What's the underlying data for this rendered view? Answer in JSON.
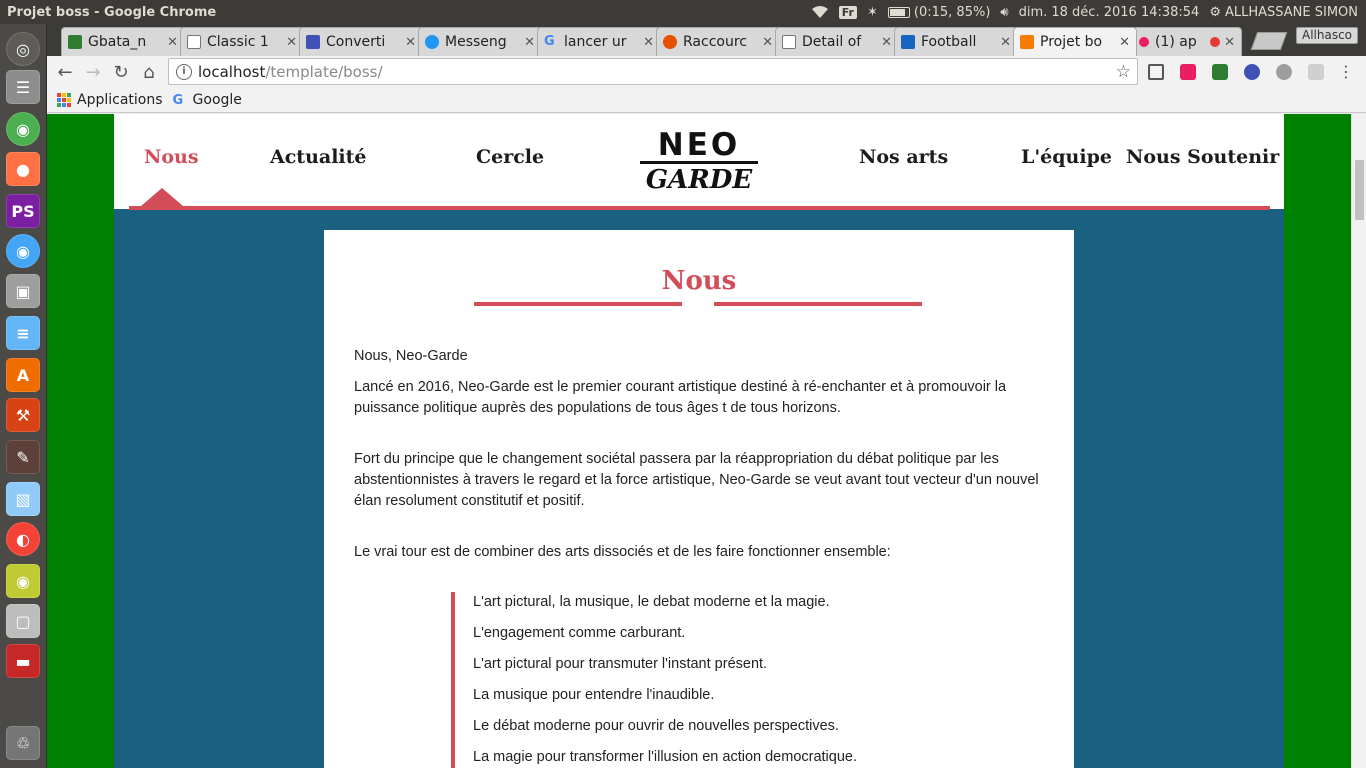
{
  "window": {
    "title": "Projet boss - Google Chrome"
  },
  "panel": {
    "keyboard": "Fr",
    "battery": "(0:15, 85%)",
    "datetime": "dim. 18 déc. 2016 14:38:54",
    "user": "ALLHASSANE SIMON"
  },
  "tabs": [
    {
      "label": "Gbata_n",
      "color": "#2e7d32"
    },
    {
      "label": "Classic 1",
      "color": "#ffffff"
    },
    {
      "label": "Converti",
      "color": "#3f51b5"
    },
    {
      "label": "Messeng",
      "color": "#2196f3"
    },
    {
      "label": "lancer ur",
      "color": "#ffffff"
    },
    {
      "label": "Raccourc",
      "color": "#e65100"
    },
    {
      "label": "Detail of",
      "color": "#ffffff"
    },
    {
      "label": "Football",
      "color": "#1565c0"
    },
    {
      "label": "Projet bo",
      "color": "#f57c00"
    },
    {
      "label": "(1) ap",
      "color": "#e91e63"
    }
  ],
  "profile": "Allhasco",
  "address": {
    "host": "localhost",
    "path": "/template/boss/"
  },
  "bookmarks": {
    "apps": "Applications",
    "google": "Google"
  },
  "site": {
    "nav": [
      "Nous",
      "Actualité",
      "Cercle",
      "Nos arts",
      "L'équipe",
      "Nous Soutenir"
    ],
    "logo": {
      "top": "NEO",
      "bottom": "GARDE"
    },
    "colors": {
      "accent": "#d24d57",
      "background": "#1a6080",
      "page": "#008000"
    },
    "card": {
      "title": "Nous",
      "p1": "Nous, Neo-Garde",
      "p2": "Lancé en 2016, Neo-Garde est le premier courant artistique destiné à ré-enchanter et à promouvoir la puissance politique auprès des populations de tous âges t de tous horizons.",
      "p3": "Fort du principe que le changement sociétal passera par la réappropriation du débat politique par les abstentionnistes à travers le regard et la force artistique, Neo-Garde se veut avant tout vecteur d'un nouvel élan resolument constitutif et positif.",
      "p4": "Le vrai tour est de combiner des arts dissociés et de les faire fonctionner ensemble:",
      "list": [
        "L'art pictural, la musique, le debat moderne et la magie.",
        "L'engagement comme carburant.",
        "L'art pictural pour transmuter l'instant présent.",
        "La musique pour entendre l'inaudible.",
        "Le débat moderne pour ouvrir de nouvelles perspectives.",
        "La magie pour transformer l'illusion en action democratique."
      ]
    }
  }
}
